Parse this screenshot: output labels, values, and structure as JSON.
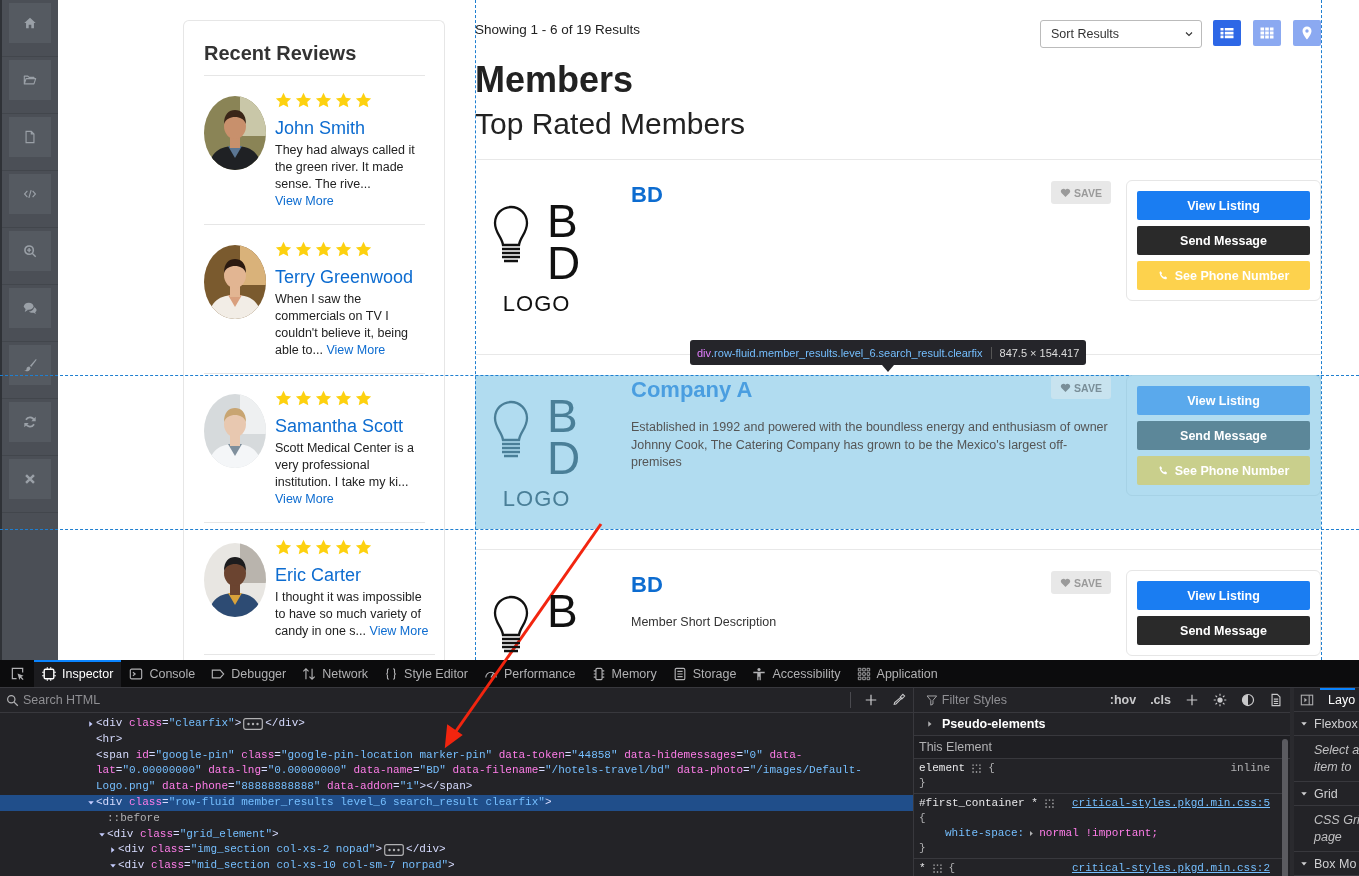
{
  "reviews": {
    "title": "Recent Reviews",
    "items": [
      {
        "stars": 5,
        "name": "John Smith",
        "text": "They had always called it the green river. It made sense. The rive...",
        "link": "View More"
      },
      {
        "stars": 5,
        "name": "Terry Greenwood",
        "text": "When I saw the commercials on TV I couldn't believe it, being able to...",
        "link": "View More"
      },
      {
        "stars": 5,
        "name": "Samantha Scott",
        "text": "Scott Medical Center is a very professional institution. I take my ki...",
        "link": "View More"
      },
      {
        "stars": 5,
        "name": "Eric Carter",
        "text": "I thought it was impossible to have so much variety of candy in one s...",
        "link": "View More"
      }
    ]
  },
  "results": {
    "summary": "Showing 1 - 6 of 19 Results",
    "sort": "Sort Results",
    "views": [
      {
        "kind": "list",
        "selected": true
      },
      {
        "kind": "grid",
        "selected": false
      },
      {
        "kind": "map",
        "selected": false
      }
    ]
  },
  "heading": "Members",
  "subheading": "Top Rated Members",
  "members": [
    {
      "logo_letters": [
        "B",
        "D"
      ],
      "logo_caption": "LOGO",
      "name": "BD",
      "save": "SAVE",
      "highlighted": false,
      "buttons": [
        {
          "kind": "view",
          "label": "View Listing"
        },
        {
          "kind": "message",
          "label": "Send Message"
        },
        {
          "kind": "phone",
          "label": "See Phone Number"
        }
      ]
    },
    {
      "logo_letters": [
        "B",
        "D"
      ],
      "logo_caption": "LOGO",
      "name": "Company A",
      "description": "Established in 1992 and powered with the boundless energy and enthusiasm of owner Johnny Cook, The Catering Company has grown to be the Mexico's largest off-premises",
      "save": "SAVE",
      "highlighted": true,
      "buttons": [
        {
          "kind": "view",
          "label": "View Listing"
        },
        {
          "kind": "message",
          "label": "Send Message"
        },
        {
          "kind": "phone",
          "label": "See Phone Number"
        }
      ]
    },
    {
      "logo_letters": [
        "B"
      ],
      "name": "BD",
      "description": "Member Short Description",
      "save": "SAVE",
      "highlighted": false,
      "buttons": [
        {
          "kind": "view",
          "label": "View Listing"
        },
        {
          "kind": "message",
          "label": "Send Message"
        }
      ]
    }
  ],
  "inspector_tooltip": {
    "tag": "div",
    "classes": ".row-fluid.member_results.level_6.search_result.clearfix",
    "size": "847.5 × 154.417"
  },
  "devtools": {
    "tabs": [
      {
        "kind": "inspector",
        "label": "Inspector",
        "selected": true
      },
      {
        "kind": "console",
        "label": "Console",
        "selected": false
      },
      {
        "kind": "debugger",
        "label": "Debugger",
        "selected": false
      },
      {
        "kind": "network",
        "label": "Network",
        "selected": false
      },
      {
        "kind": "style-editor",
        "label": "Style Editor",
        "selected": false
      },
      {
        "kind": "performance",
        "label": "Performance",
        "selected": false
      },
      {
        "kind": "memory",
        "label": "Memory",
        "selected": false
      },
      {
        "kind": "storage",
        "label": "Storage",
        "selected": false
      },
      {
        "kind": "accessibility",
        "label": "Accessibility",
        "selected": false
      },
      {
        "kind": "application",
        "label": "Application",
        "selected": false
      }
    ],
    "search_placeholder": "Search HTML",
    "markup": [
      {
        "kind": "element",
        "open": "<div class=\"clearfix\">",
        "close": "</div>",
        "expanded": false,
        "selected": false
      },
      {
        "kind": "element",
        "open": "<hr>",
        "selected": false
      },
      {
        "kind": "element",
        "open": "<span id=\"google-pin\" class=\"google-pin-location marker-pin\" data-token=\"44858\" data-hidemessages=\"0\" data-lat=\"0.00000000\" data-lng=\"0.00000000\" data-name=\"BD\" data-filename=\"/hotels-travel/bd\" data-photo=\"/images/Default-Logo.png\" data-phone=\"88888888888\" data-addon=\"1\">",
        "close": "</span>",
        "selected": false
      },
      {
        "kind": "element",
        "open": "<div class=\"row-fluid member_results level_6 search_result clearfix\">",
        "expanded": true,
        "selected": true,
        "children": [
          {
            "kind": "pseudo",
            "open": "::before",
            "selected": false
          },
          {
            "kind": "element",
            "open": "<div class=\"grid_element\">",
            "expanded": true,
            "selected": false,
            "children": [
              {
                "kind": "element",
                "open": "<div class=\"img_section col-xs-2 nopad\">",
                "close": "</div>",
                "expanded": false,
                "selected": false
              },
              {
                "kind": "element",
                "open": "<div class=\"mid_section col-xs-10 col-sm-7 norpad\">",
                "expanded": true,
                "selected": false
              }
            ]
          }
        ]
      }
    ],
    "styles": {
      "filter_placeholder": "Filter Styles",
      "toggles": [
        ":hov",
        ".cls"
      ],
      "pseudo_elements": {
        "label": "Pseudo-elements",
        "expanded": false
      },
      "section": "This Element",
      "rules": [
        {
          "selector": "element",
          "origin": "inline",
          "open": "{",
          "close": "}",
          "brace_wrapped": false
        },
        {
          "selector": "#first_container *",
          "link": "critical-styles.pkgd.min.css:5",
          "open": "{",
          "close": "}",
          "brace_wrapped": true,
          "declarations": [
            {
              "property": "white-space:",
              "value": "normal !important;"
            }
          ]
        },
        {
          "selector": "*",
          "link": "critical-styles.pkgd.min.css:2",
          "open": "{",
          "brace_wrapped": false
        }
      ]
    },
    "layout": {
      "tab": {
        "label": "Layo",
        "selected": true
      },
      "sections": [
        {
          "title": "Flexbox",
          "expanded": true,
          "note": [
            "Select a",
            "item to"
          ]
        },
        {
          "title": "Grid",
          "expanded": true,
          "note": [
            "CSS Gri",
            "page"
          ]
        },
        {
          "title": "Box Mo",
          "expanded": true
        }
      ]
    }
  }
}
